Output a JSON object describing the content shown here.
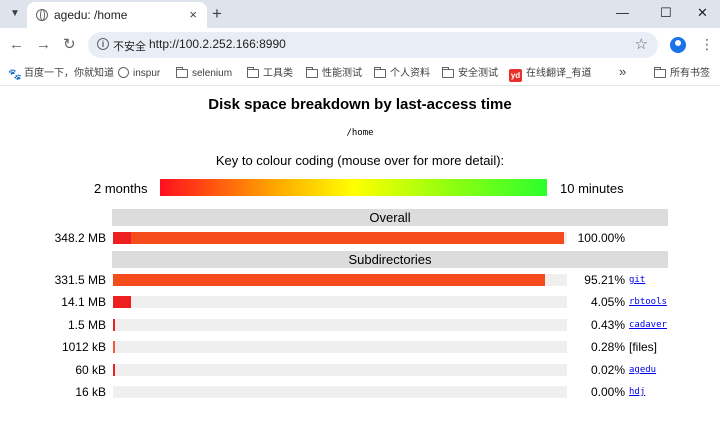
{
  "browser": {
    "tab_title": "agedu: /home",
    "tab_close": "×",
    "new_tab": "+",
    "window_controls": {
      "minimize": "—",
      "maximize": "☐",
      "close": "✕"
    },
    "nav": {
      "back": "←",
      "forward": "→",
      "reload": "↻"
    },
    "address": {
      "security_label": "不安全",
      "url": "http://100.2.252.166:8990"
    },
    "star": "☆",
    "menu": "⋮",
    "bookmarks": [
      {
        "label": "百度一下，你就知道",
        "icon": "baidu-icon"
      },
      {
        "label": "inspur",
        "icon": "globe-icon"
      },
      {
        "label": "selenium",
        "icon": "folder-icon"
      },
      {
        "label": "工具类",
        "icon": "folder-icon"
      },
      {
        "label": "性能测试",
        "icon": "folder-icon"
      },
      {
        "label": "个人资料",
        "icon": "folder-icon"
      },
      {
        "label": "安全测试",
        "icon": "folder-icon"
      },
      {
        "label": "在线翻译_有道",
        "icon": "youdao-icon"
      }
    ],
    "bookmarks_more": "»",
    "all_bookmarks": "所有书签"
  },
  "page": {
    "title": "Disk space breakdown by last-access time",
    "path": "/home",
    "key_text": "Key to colour coding (mouse over for more detail):",
    "key_left": "2 months",
    "key_right": "10 minutes",
    "overall_header": "Overall",
    "subdirs_header": "Subdirectories",
    "overall": {
      "size": "348.2 MB",
      "percent": "100.00%",
      "old_fraction": 0.04,
      "recent_fraction": 0.96
    },
    "rows": [
      {
        "size": "331.5 MB",
        "percent": "95.21%",
        "name": "git",
        "fraction": 0.9521,
        "link": true,
        "color": "#f54a1c"
      },
      {
        "size": "14.1 MB",
        "percent": "4.05%",
        "name": "rbtools",
        "fraction": 0.0405,
        "link": true,
        "color": "#ee1f1f"
      },
      {
        "size": "1.5 MB",
        "percent": "0.43%",
        "name": "cadaver",
        "fraction": 0.0043,
        "link": true,
        "color": "#ee1f1f"
      },
      {
        "size": "1012 kB",
        "percent": "0.28%",
        "name": "[files]",
        "fraction": 0.0028,
        "link": false,
        "color": "#f35a3a"
      },
      {
        "size": "60 kB",
        "percent": "0.02%",
        "name": "agedu",
        "fraction": 0.0002,
        "link": true,
        "color": "#ee1f1f"
      },
      {
        "size": "16 kB",
        "percent": "0.00%",
        "name": "hdj",
        "fraction": 0.0,
        "link": true,
        "color": "#ee1f1f"
      }
    ],
    "colors": {
      "old": "#ee1f1f",
      "recent": "#f54a1c",
      "track": "#efefef",
      "header_bg": "#dcdcdc"
    }
  }
}
